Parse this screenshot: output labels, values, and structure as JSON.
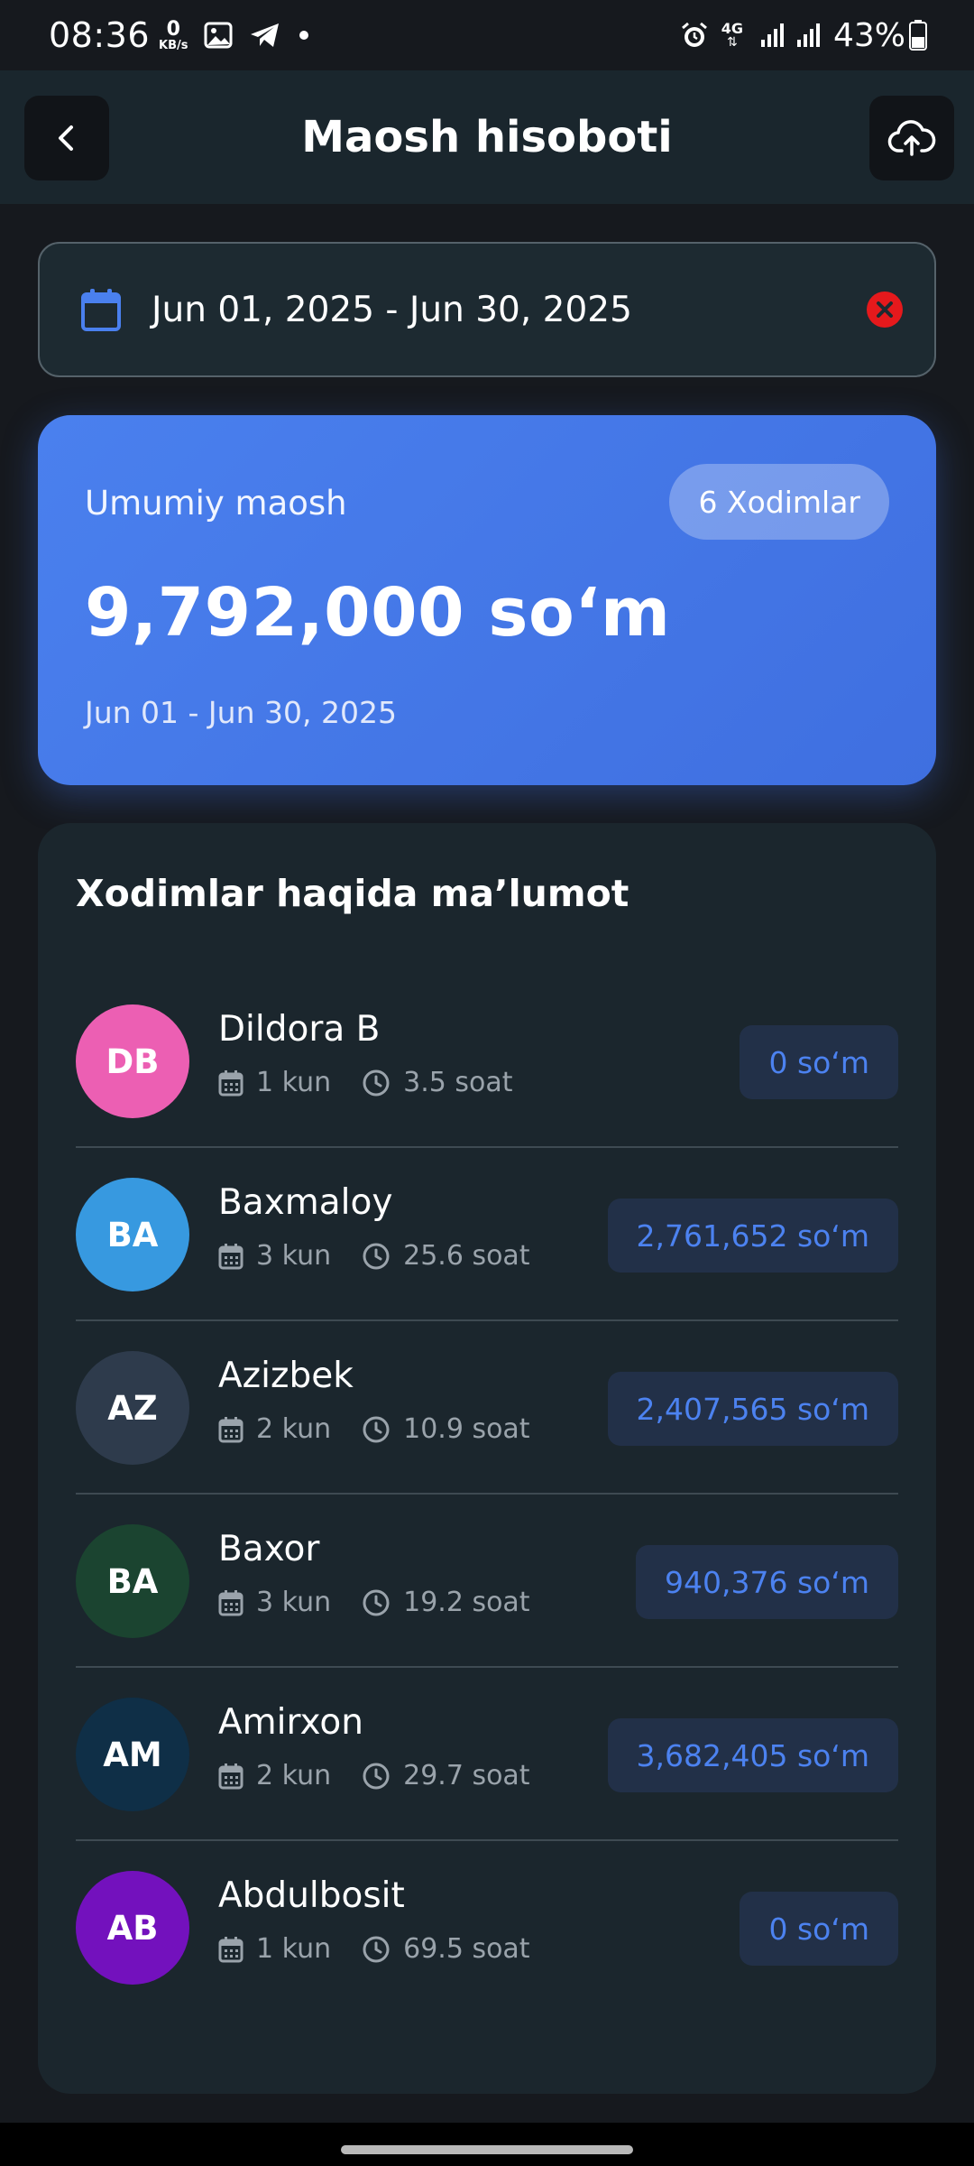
{
  "status_bar": {
    "time": "08:36",
    "net_speed_value": "0",
    "net_speed_unit": "KB/s",
    "network_type": "4G",
    "battery": "43%"
  },
  "header": {
    "title": "Maosh hisoboti",
    "back_icon": "chevron-left-icon",
    "upload_icon": "cloud-upload-icon"
  },
  "date_filter": {
    "range": "Jun 01, 2025 - Jun 30, 2025",
    "calendar_icon": "calendar-icon",
    "clear_icon": "clear-icon"
  },
  "summary": {
    "label": "Umumiy maosh",
    "employees_badge": "6 Xodimlar",
    "total": "9,792,000 so‘m",
    "period": "Jun 01 - Jun 30, 2025"
  },
  "employees_section": {
    "title": "Xodimlar haqida ma’lumot",
    "items": [
      {
        "initials": "DB",
        "name": "Dildora B",
        "days": "1 kun",
        "hours": "3.5 soat",
        "amount": "0 so‘m",
        "avatar_color": "#ec5fb3"
      },
      {
        "initials": "BA",
        "name": "Baxmaloy",
        "days": "3 kun",
        "hours": "25.6 soat",
        "amount": "2,761,652 so‘m",
        "avatar_color": "#3799e0"
      },
      {
        "initials": "AZ",
        "name": "Azizbek",
        "days": "2 kun",
        "hours": "10.9 soat",
        "amount": "2,407,565 so‘m",
        "avatar_color": "#2e3b4c"
      },
      {
        "initials": "BA",
        "name": "Baxor",
        "days": "3 kun",
        "hours": "19.2 soat",
        "amount": "940,376 so‘m",
        "avatar_color": "#1b4430"
      },
      {
        "initials": "AM",
        "name": "Amirxon",
        "days": "2 kun",
        "hours": "29.7 soat",
        "amount": "3,682,405 so‘m",
        "avatar_color": "#0f2f47"
      },
      {
        "initials": "AB",
        "name": "Abdulbosit",
        "days": "1 kun",
        "hours": "69.5 soat",
        "amount": "0 so‘m",
        "avatar_color": "#7311bd"
      }
    ]
  },
  "colors": {
    "accent": "#4a80ee",
    "amount_text": "#4c82f0",
    "clear_red": "#e5191c"
  }
}
